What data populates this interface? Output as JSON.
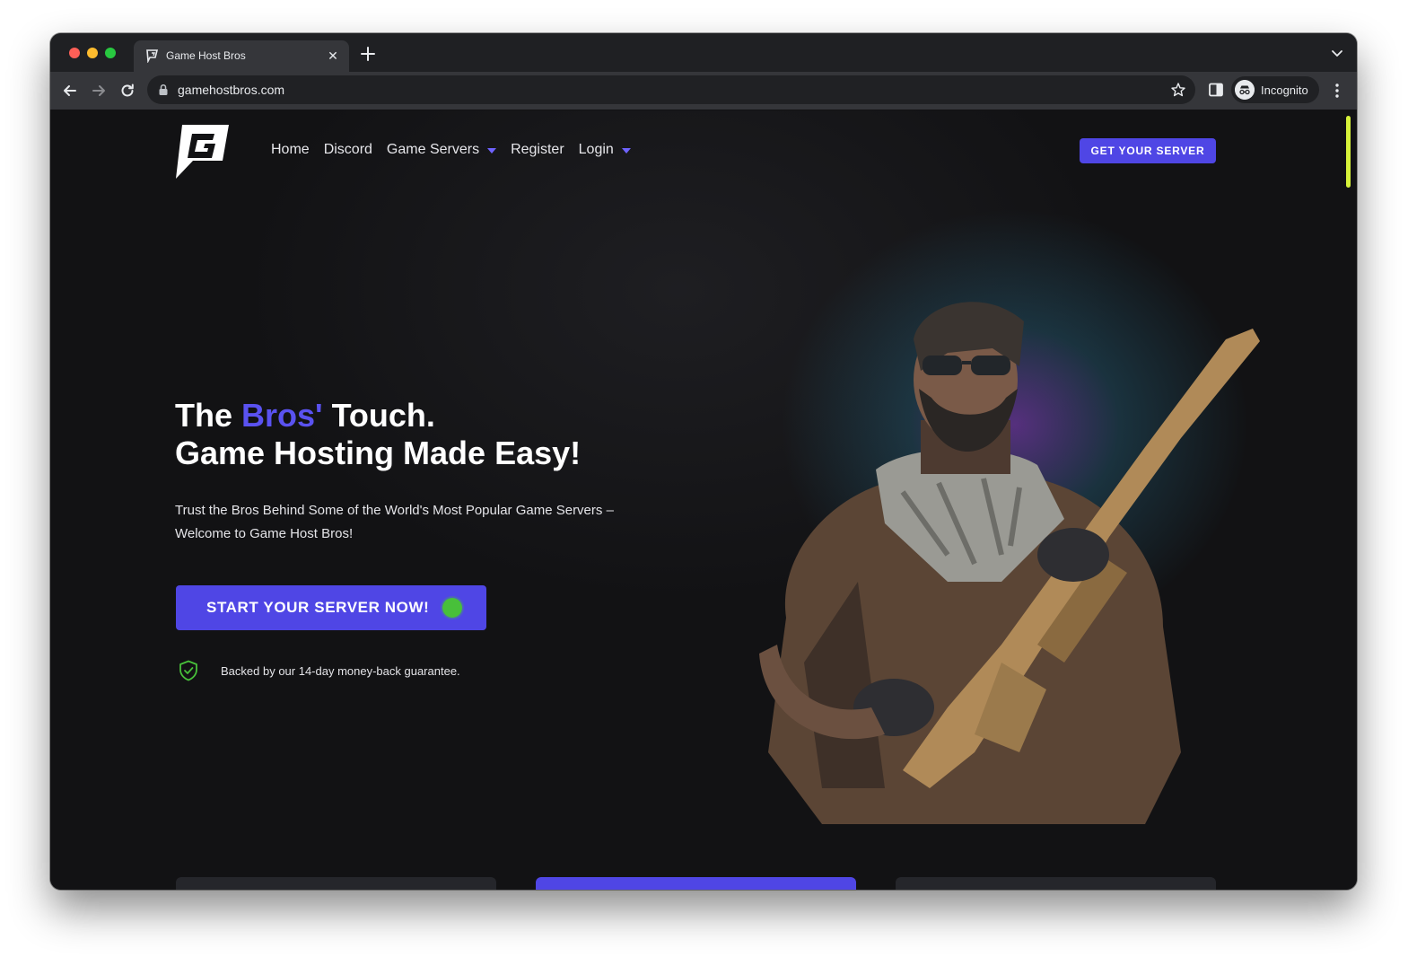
{
  "browser": {
    "tab_title": "Game Host Bros",
    "tab_close": "✕",
    "url": "gamehostbros.com",
    "profile_label": "Incognito"
  },
  "site": {
    "nav": {
      "home": "Home",
      "discord": "Discord",
      "game_servers": "Game Servers",
      "register": "Register",
      "login": "Login"
    },
    "header_cta": "GET YOUR SERVER",
    "hero": {
      "headline_part1": "The ",
      "headline_accent": "Bros'",
      "headline_part2": " Touch.",
      "headline_line2": "Game Hosting Made Easy!",
      "subtext_line1": "Trust the Bros Behind Some of the World's Most Popular Game Servers –",
      "subtext_line2": "Welcome to Game Host Bros!",
      "cta": "START YOUR SERVER NOW!",
      "guarantee": "Backed by our 14-day money-back guarantee."
    }
  },
  "colors": {
    "accent": "#4f46e5",
    "accent_text": "#5a52f0",
    "status_dot": "#48c03a",
    "scrollbar": "#d6f23a",
    "page_bg": "#121214"
  },
  "icons": [
    "site-favicon-icon",
    "new-tab-icon",
    "tab-search-icon",
    "back-icon",
    "forward-icon",
    "reload-icon",
    "lock-icon",
    "bookmark-star-icon",
    "side-panel-icon",
    "incognito-icon",
    "more-menu-icon",
    "caret-down-icon",
    "shield-check-icon"
  ]
}
